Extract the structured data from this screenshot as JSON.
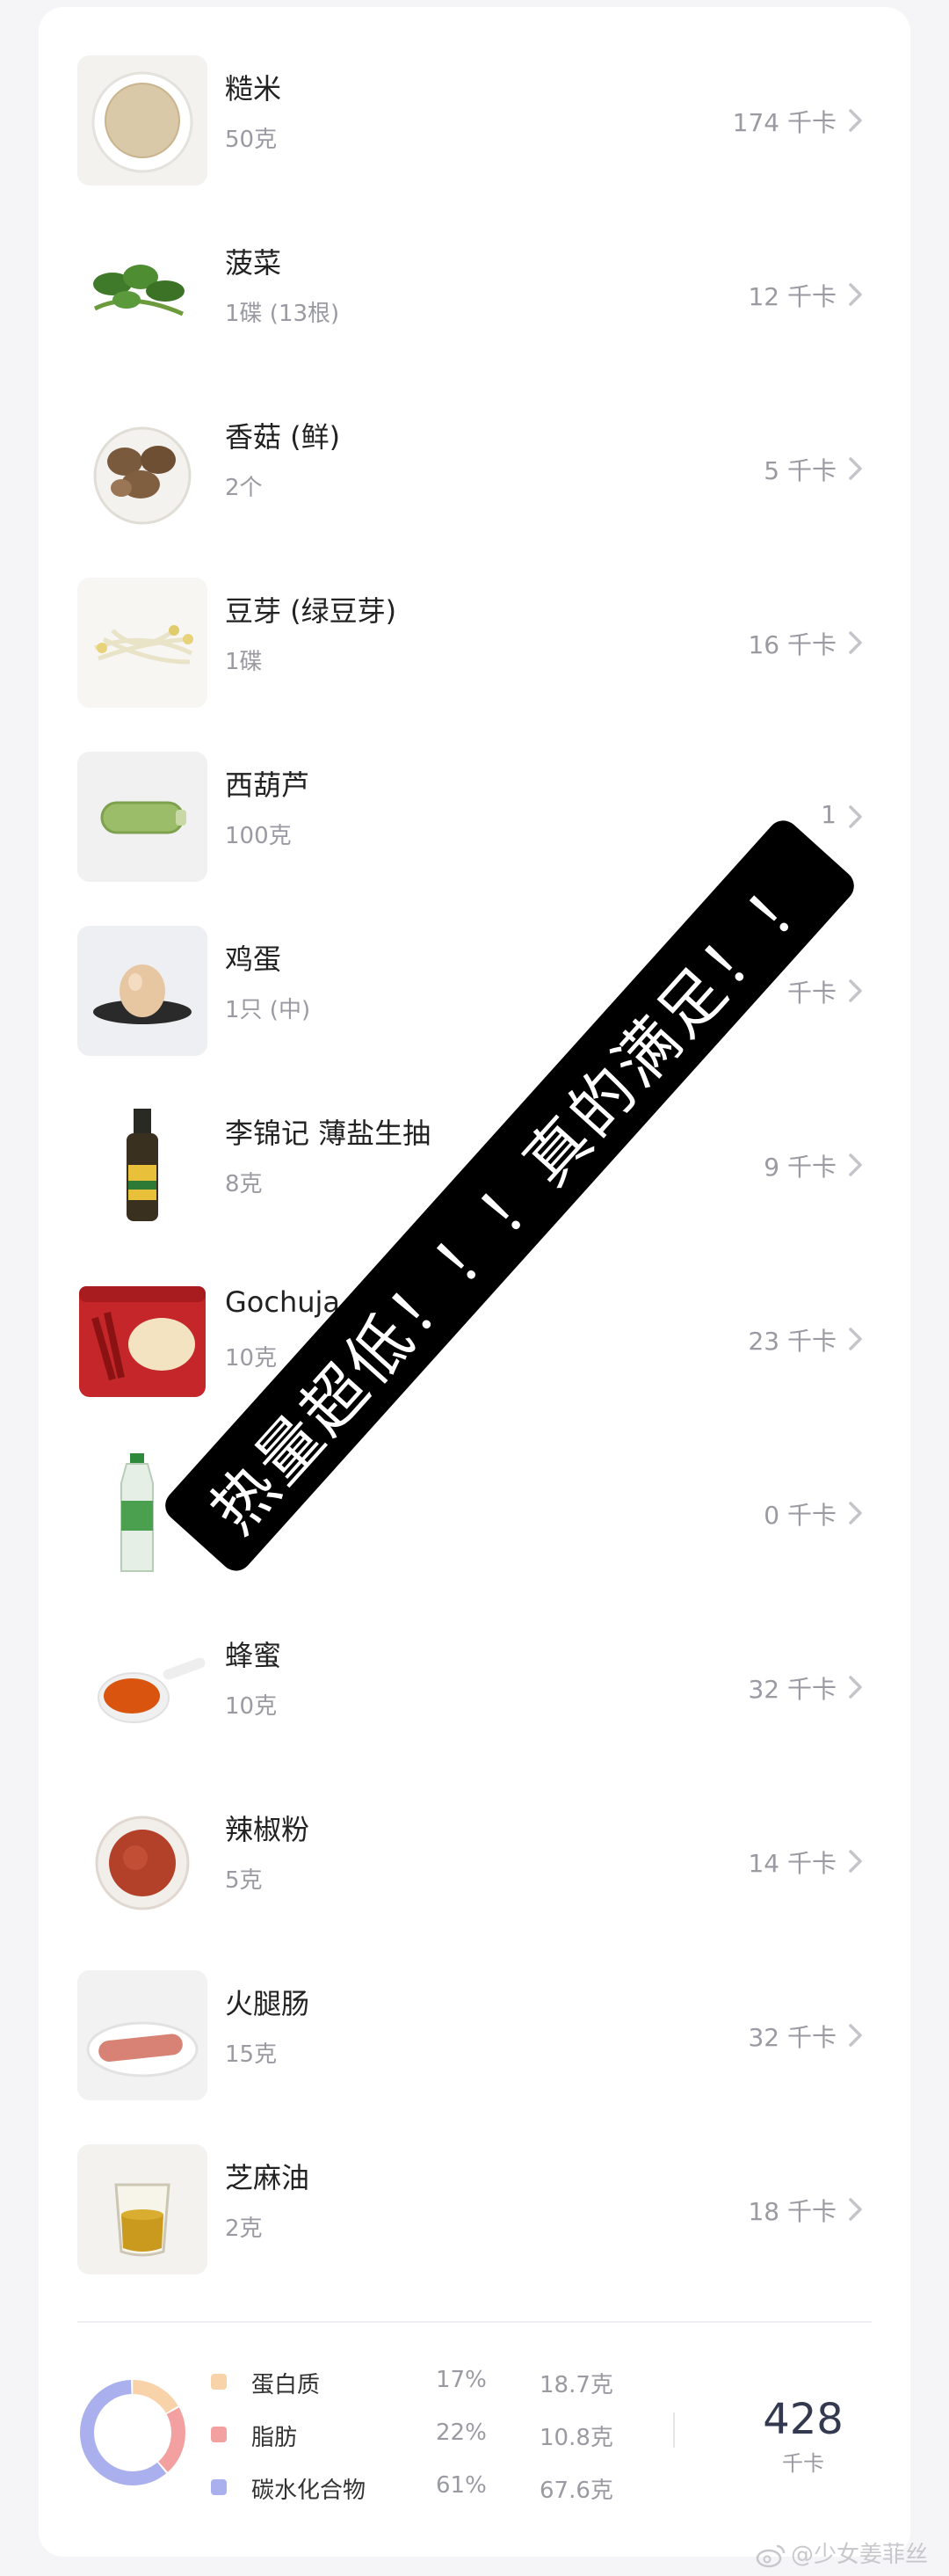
{
  "items": [
    {
      "name": "糙米",
      "amount": "50克",
      "kcal": "174 千卡",
      "icon": "brown-rice-icon"
    },
    {
      "name": "菠菜",
      "amount": "1碟 (13根)",
      "kcal": "12 千卡",
      "icon": "spinach-icon"
    },
    {
      "name": "香菇 (鲜)",
      "amount": "2个",
      "kcal": "5 千卡",
      "icon": "mushroom-icon"
    },
    {
      "name": "豆芽 (绿豆芽)",
      "amount": "1碟",
      "kcal": "16 千卡",
      "icon": "bean-sprout-icon"
    },
    {
      "name": "西葫芦",
      "amount": "100克",
      "kcal": "1",
      "icon": "zucchini-icon"
    },
    {
      "name": "鸡蛋",
      "amount": "1只 (中)",
      "kcal": "千卡",
      "icon": "egg-icon"
    },
    {
      "name": "李锦记 薄盐生抽",
      "amount": "8克",
      "kcal": "9 千卡",
      "icon": "soy-sauce-icon"
    },
    {
      "name": "Gochuja",
      "amount": "10克",
      "kcal": "23 千卡",
      "icon": "gochujang-icon"
    },
    {
      "name": "",
      "amount": "",
      "kcal": "0 千卡",
      "icon": "soda-bottle-icon"
    },
    {
      "name": "蜂蜜",
      "amount": "10克",
      "kcal": "32 千卡",
      "icon": "honey-icon"
    },
    {
      "name": "辣椒粉",
      "amount": "5克",
      "kcal": "14 千卡",
      "icon": "chili-powder-icon"
    },
    {
      "name": "火腿肠",
      "amount": "15克",
      "kcal": "32 千卡",
      "icon": "sausage-icon"
    },
    {
      "name": "芝麻油",
      "amount": "2克",
      "kcal": "18 千卡",
      "icon": "sesame-oil-icon"
    }
  ],
  "macros": [
    {
      "name": "蛋白质",
      "percent": "17%",
      "grams": "18.7克",
      "color": "#f8d2a8",
      "share": 0.17
    },
    {
      "name": "脂肪",
      "percent": "22%",
      "grams": "10.8克",
      "color": "#f2a0a0",
      "share": 0.22
    },
    {
      "name": "碳水化合物",
      "percent": "61%",
      "grams": "67.6克",
      "color": "#aab0ee",
      "share": 0.61
    }
  ],
  "total": {
    "value": "428",
    "unit": "千卡"
  },
  "overlay_text": "热量超低！！！真的满足！！",
  "watermark": "@少女姜菲丝",
  "colors": {
    "chevron": "#c4c4ca",
    "kcal_text": "#9a9aa2"
  }
}
